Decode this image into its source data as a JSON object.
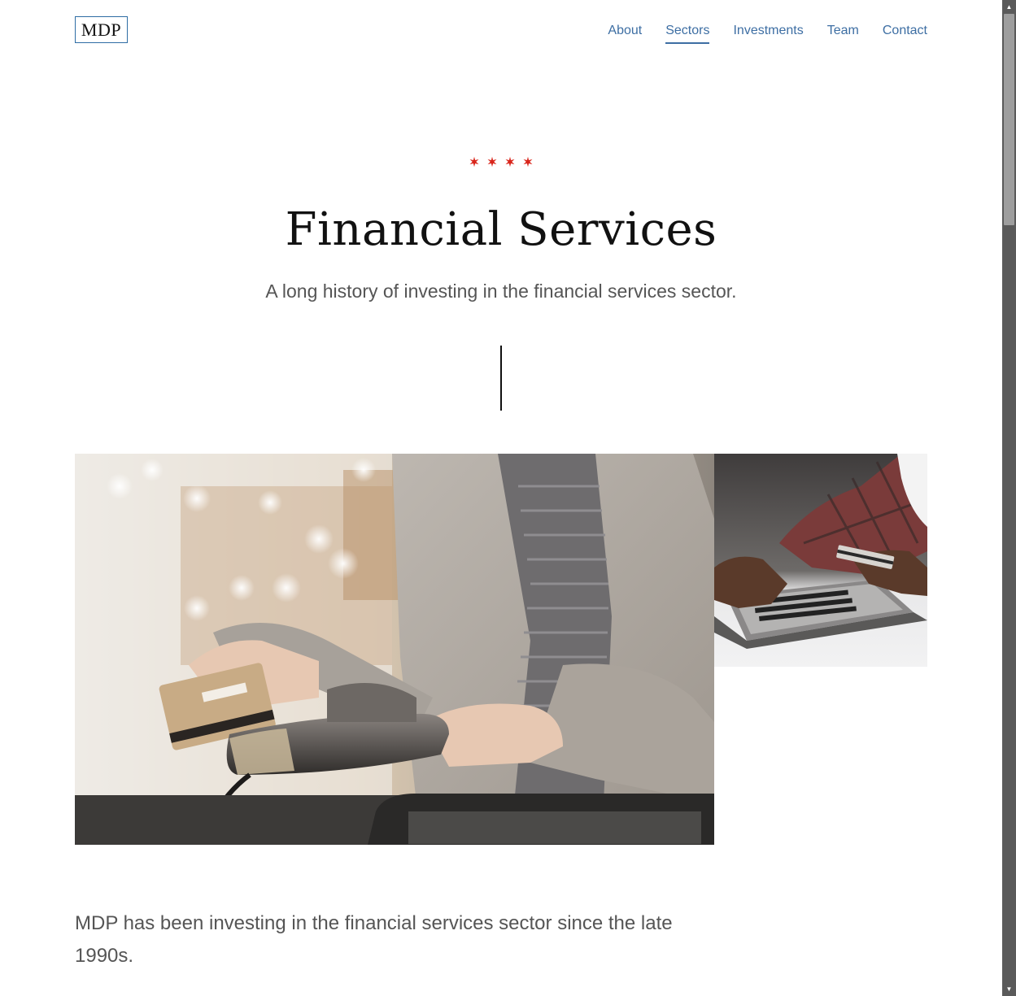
{
  "header": {
    "logo_text": "MDP",
    "nav": [
      {
        "label": "About",
        "active": false
      },
      {
        "label": "Sectors",
        "active": true
      },
      {
        "label": "Investments",
        "active": false
      },
      {
        "label": "Team",
        "active": false
      },
      {
        "label": "Contact",
        "active": false
      }
    ]
  },
  "hero": {
    "stars_count": 4,
    "title": "Financial Services",
    "subtitle": "A long history of investing in the financial services sector."
  },
  "images": {
    "main_icon": "photo-card-payment-terminal",
    "side_icon": "photo-laptop-credit-card"
  },
  "body": {
    "intro": "MDP has been investing in the financial services sector since the late 1990s."
  },
  "colors": {
    "accent": "#3d6ea3",
    "star": "#d9261c",
    "text_dark": "#111111",
    "text_muted": "#555555"
  }
}
